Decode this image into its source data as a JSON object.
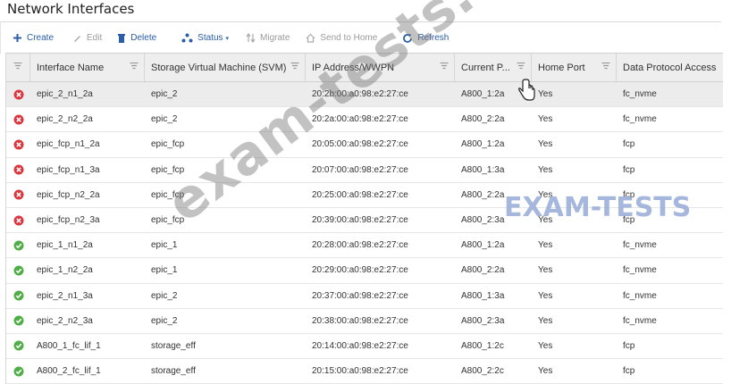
{
  "page": {
    "title": "Network Interfaces"
  },
  "toolbar": {
    "buttons": [
      {
        "label": "Create",
        "icon": "plus-icon",
        "enabled": true
      },
      {
        "label": "Edit",
        "icon": "pencil-icon",
        "enabled": false
      },
      {
        "label": "Delete",
        "icon": "trash-icon",
        "enabled": true
      },
      {
        "label": "Status",
        "icon": "status-icon",
        "enabled": true,
        "has_dropdown": true
      },
      {
        "label": "Migrate",
        "icon": "migrate-icon",
        "enabled": false
      },
      {
        "label": "Send to Home",
        "icon": "home-icon",
        "enabled": false
      },
      {
        "label": "Refresh",
        "icon": "refresh-icon",
        "enabled": true
      }
    ]
  },
  "table": {
    "columns": [
      "",
      "Interface Name",
      "Storage Virtual Machine (SVM)",
      "IP Address/WWPN",
      "Current P...",
      "Home Port",
      "Data Protocol Access"
    ],
    "status_colors": {
      "down": "#d9363e",
      "up": "#4fae45"
    },
    "rows": [
      {
        "status": "down",
        "name": "epic_2_n1_2a",
        "svm": "epic_2",
        "wwpn": "20:2b:00:a0:98:e2:27:ce",
        "current_port": "A800_1:2a",
        "home_port": "Yes",
        "protocol": "fc_nvme",
        "selected": true
      },
      {
        "status": "down",
        "name": "epic_2_n2_2a",
        "svm": "epic_2",
        "wwpn": "20:2a:00:a0:98:e2:27:ce",
        "current_port": "A800_2:2a",
        "home_port": "Yes",
        "protocol": "fc_nvme"
      },
      {
        "status": "down",
        "name": "epic_fcp_n1_2a",
        "svm": "epic_fcp",
        "wwpn": "20:05:00:a0:98:e2:27:ce",
        "current_port": "A800_1:2a",
        "home_port": "Yes",
        "protocol": "fcp"
      },
      {
        "status": "down",
        "name": "epic_fcp_n1_3a",
        "svm": "epic_fcp",
        "wwpn": "20:07:00:a0:98:e2:27:ce",
        "current_port": "A800_1:3a",
        "home_port": "Yes",
        "protocol": "fcp"
      },
      {
        "status": "down",
        "name": "epic_fcp_n2_2a",
        "svm": "epic_fcp",
        "wwpn": "20:25:00:a0:98:e2:27:ce",
        "current_port": "A800_2:2a",
        "home_port": "Yes",
        "protocol": "fcp"
      },
      {
        "status": "down",
        "name": "epic_fcp_n2_3a",
        "svm": "epic_fcp",
        "wwpn": "20:39:00:a0:98:e2:27:ce",
        "current_port": "A800_2:3a",
        "home_port": "Yes",
        "protocol": "fcp"
      },
      {
        "status": "up",
        "name": "epic_1_n1_2a",
        "svm": "epic_1",
        "wwpn": "20:28:00:a0:98:e2:27:ce",
        "current_port": "A800_1:2a",
        "home_port": "Yes",
        "protocol": "fc_nvme"
      },
      {
        "status": "up",
        "name": "epic_1_n2_2a",
        "svm": "epic_1",
        "wwpn": "20:29:00:a0:98:e2:27:ce",
        "current_port": "A800_2:2a",
        "home_port": "Yes",
        "protocol": "fc_nvme"
      },
      {
        "status": "up",
        "name": "epic_2_n1_3a",
        "svm": "epic_2",
        "wwpn": "20:37:00:a0:98:e2:27:ce",
        "current_port": "A800_1:3a",
        "home_port": "Yes",
        "protocol": "fc_nvme"
      },
      {
        "status": "up",
        "name": "epic_2_n2_3a",
        "svm": "epic_2",
        "wwpn": "20:38:00:a0:98:e2:27:ce",
        "current_port": "A800_2:3a",
        "home_port": "Yes",
        "protocol": "fc_nvme"
      },
      {
        "status": "up",
        "name": "A800_1_fc_lif_1",
        "svm": "storage_eff",
        "wwpn": "20:14:00:a0:98:e2:27:ce",
        "current_port": "A800_1:2c",
        "home_port": "Yes",
        "protocol": "fcp"
      },
      {
        "status": "up",
        "name": "A800_2_fc_lif_1",
        "svm": "storage_eff",
        "wwpn": "20:15:00:a0:98:e2:27:ce",
        "current_port": "A800_2:2c",
        "home_port": "Yes",
        "protocol": "fcp"
      }
    ]
  },
  "watermarks": {
    "primary": "exam-tests.com",
    "secondary": "EXAM-TESTS"
  }
}
